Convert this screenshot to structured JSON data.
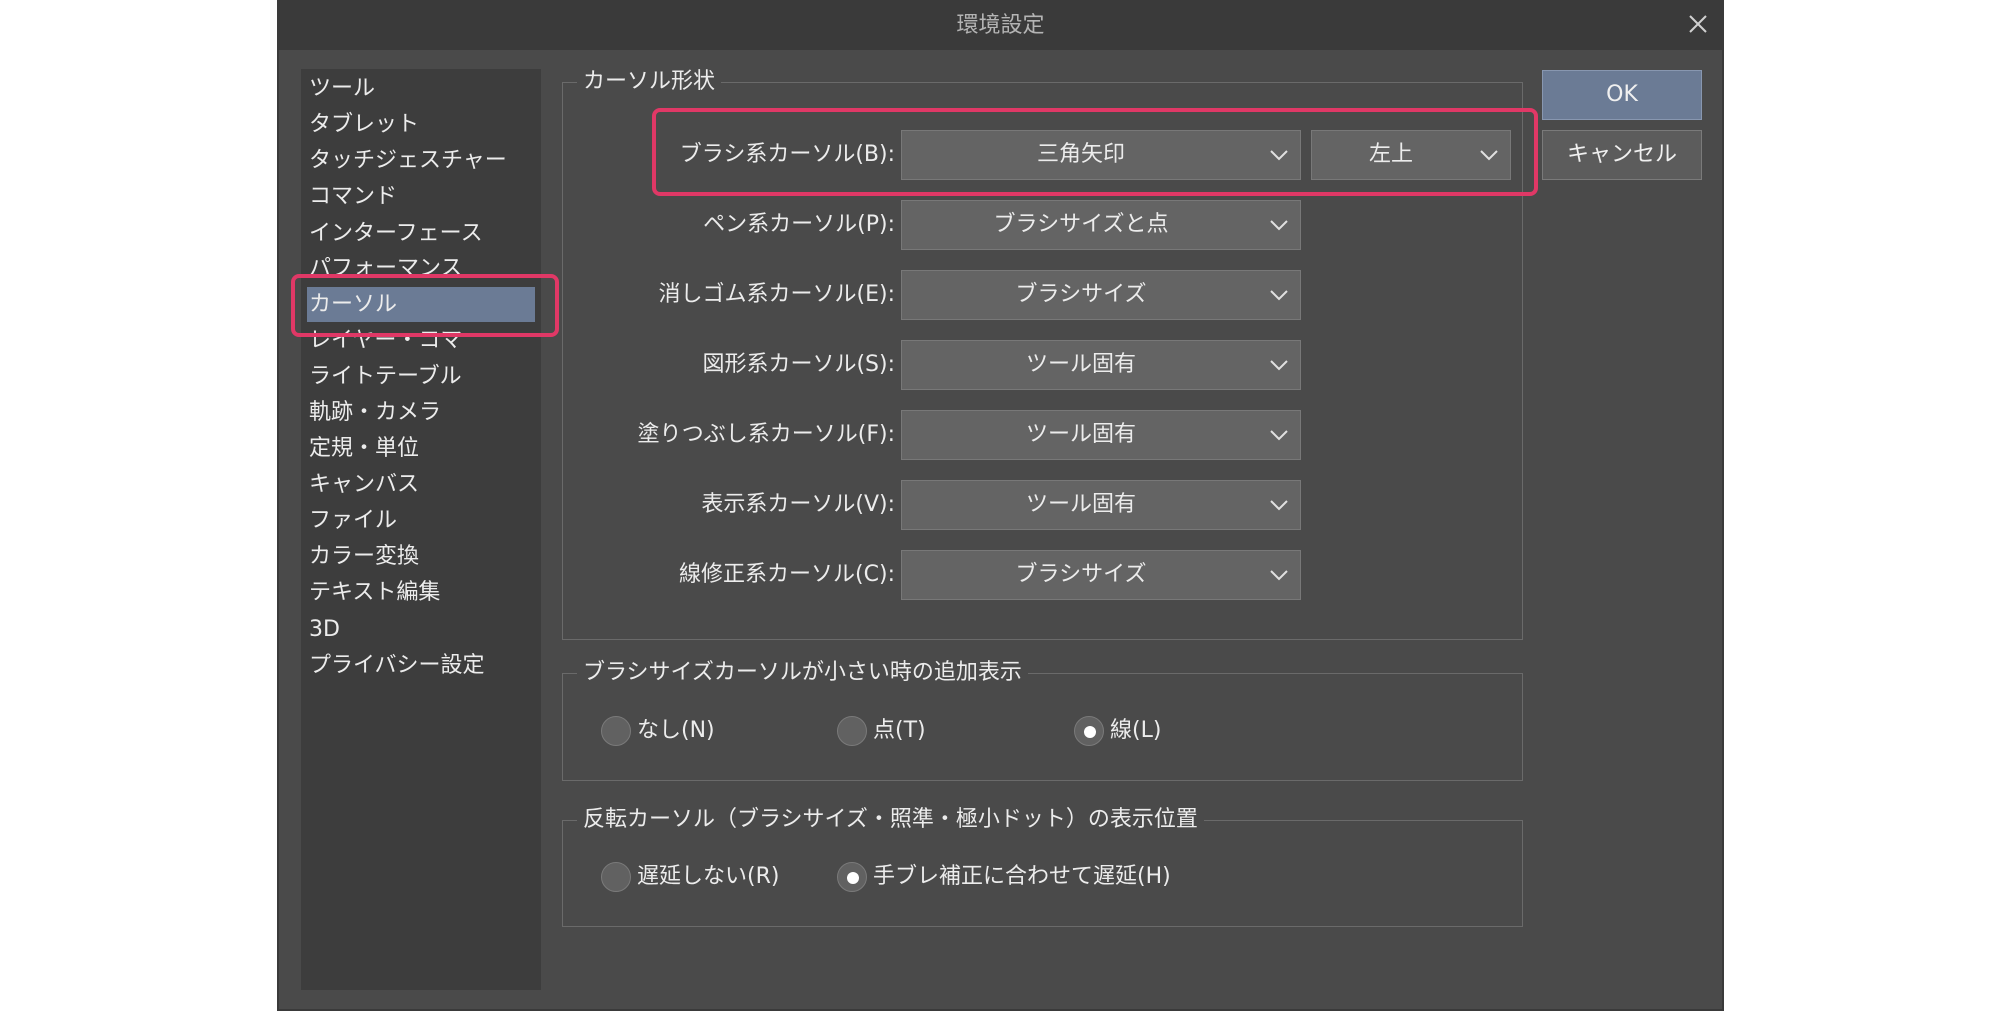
{
  "window": {
    "title": "環境設定"
  },
  "sidebar": {
    "items": [
      {
        "label": "ツール"
      },
      {
        "label": "タブレット"
      },
      {
        "label": "タッチジェスチャー"
      },
      {
        "label": "コマンド"
      },
      {
        "label": "インターフェース"
      },
      {
        "label": "パフォーマンス"
      },
      {
        "label": "カーソル",
        "selected": true
      },
      {
        "label": "レイヤー・コマ"
      },
      {
        "label": "ライトテーブル"
      },
      {
        "label": "軌跡・カメラ"
      },
      {
        "label": "定規・単位"
      },
      {
        "label": "キャンバス"
      },
      {
        "label": "ファイル"
      },
      {
        "label": "カラー変換"
      },
      {
        "label": "テキスト編集"
      },
      {
        "label": "3D"
      },
      {
        "label": "プライバシー設定"
      }
    ]
  },
  "cursor_shape": {
    "title": "カーソル形状",
    "rows": [
      {
        "label": "ブラシ系カーソル(B):",
        "value": "三角矢印",
        "extra_value": "左上"
      },
      {
        "label": "ペン系カーソル(P):",
        "value": "ブラシサイズと点"
      },
      {
        "label": "消しゴム系カーソル(E):",
        "value": "ブラシサイズ"
      },
      {
        "label": "図形系カーソル(S):",
        "value": "ツール固有"
      },
      {
        "label": "塗りつぶし系カーソル(F):",
        "value": "ツール固有"
      },
      {
        "label": "表示系カーソル(V):",
        "value": "ツール固有"
      },
      {
        "label": "線修正系カーソル(C):",
        "value": "ブラシサイズ"
      }
    ]
  },
  "small_cursor": {
    "title": "ブラシサイズカーソルが小さい時の追加表示",
    "options": [
      {
        "label": "なし(N)",
        "checked": false
      },
      {
        "label": "点(T)",
        "checked": false
      },
      {
        "label": "線(L)",
        "checked": true
      }
    ]
  },
  "reverse_cursor": {
    "title": "反転カーソル（ブラシサイズ・照準・極小ドット）の表示位置",
    "options": [
      {
        "label": "遅延しない(R)",
        "checked": false
      },
      {
        "label": "手ブレ補正に合わせて遅延(H)",
        "checked": true
      }
    ]
  },
  "buttons": {
    "ok": "OK",
    "cancel": "キャンセル"
  },
  "colors": {
    "dialog_bg": "#4a4a4a",
    "titlebar_bg": "#3a3a3a",
    "sidebar_bg": "#3d3d3d",
    "selected_bg": "#6b7b95",
    "highlight": "#e03866"
  }
}
